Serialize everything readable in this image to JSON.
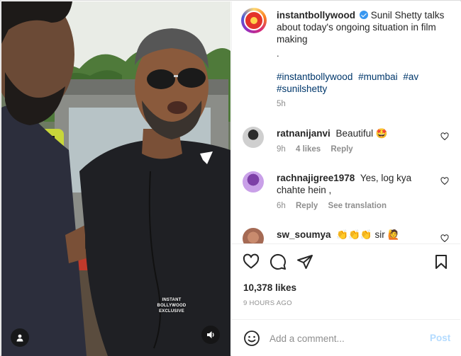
{
  "post": {
    "username": "instantbollywood",
    "verified": true,
    "caption": "Sunil Shetty talks about today's ongoing situation in film making",
    "caption_tail": ".",
    "hashtags": [
      "#instantbollywood",
      "#mumbai",
      "#av",
      "#sunilshetty"
    ],
    "age": "5h"
  },
  "comments": [
    {
      "username": "ratnanijanvi",
      "text": "Beautiful 🤩",
      "age": "9h",
      "likes": "4 likes",
      "reply": "Reply",
      "avatar_icon": "user-avatar"
    },
    {
      "username": "rachnajigree1978",
      "text": "Yes, log kya chahte hein ,",
      "age": "6h",
      "reply": "Reply",
      "see_translation": "See translation",
      "avatar_icon": "user-avatar"
    },
    {
      "username": "sw_soumya",
      "text": "👏👏👏 sir 🙋",
      "avatar_icon": "user-avatar"
    }
  ],
  "media": {
    "watermark_line1": "INSTANT BOLLYWOOD",
    "watermark_line2": "EXCLUSIVE",
    "user_tag_icon": "user-icon",
    "sound_icon": "speaker-icon"
  },
  "actions": {
    "like_icon": "heart-icon",
    "comment_icon": "comment-bubble-icon",
    "share_icon": "paper-plane-icon",
    "save_icon": "bookmark-icon"
  },
  "likes_count": "10,378 likes",
  "time_ago": "9 HOURS AGO",
  "add_comment": {
    "placeholder": "Add a comment...",
    "post_label": "Post",
    "emoji_icon": "smiley-icon"
  },
  "colors": {
    "link": "#00376b",
    "muted": "#8e8e8e",
    "post_disabled": "#b3dbff",
    "verified": "#3897f0"
  }
}
